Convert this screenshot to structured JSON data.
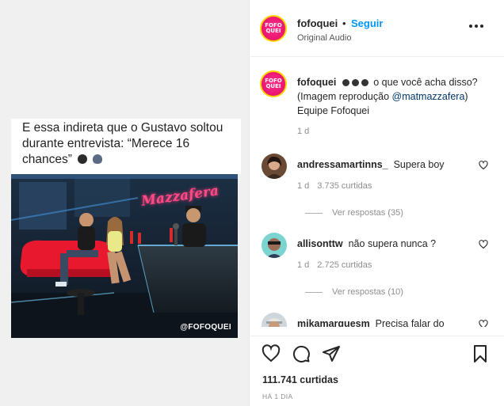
{
  "media": {
    "caption_line1": "E essa indireta que o Gustavo soltou",
    "caption_line2": "durante entrevista: “Merece 16",
    "caption_line3": "chances”",
    "brand_sign": "Mazzafera",
    "watermark": "@FOFOQUEI"
  },
  "post": {
    "logo_text_top": "FOFO",
    "logo_text_bottom": "QUEI",
    "username": "fofoquei",
    "dot": "•",
    "follow_label": "Seguir",
    "audio": "Original Audio",
    "caption": {
      "username": "fofoquei",
      "text_after_emojis": " o que você acha disso?",
      "line2_prefix": "(Imagem reprodução ",
      "mention": "@matmazzafera",
      "line2_suffix": ")",
      "line3": "Equipe Fofoquei",
      "time": "1 d"
    }
  },
  "comments": [
    {
      "username": "andressamartinns_",
      "text": "Supera boy",
      "time": "1 d",
      "likes": "3.735 curtidas",
      "replies": "Ver respostas (35)"
    },
    {
      "username": "allisonttw",
      "text": "não supera nunca ?",
      "time": "1 d",
      "likes": "2.725 curtidas",
      "replies": "Ver respostas (10)"
    },
    {
      "username": "mikamarquesm",
      "text": "Precisa falar do"
    }
  ],
  "actions": {
    "like_icon": "heart-icon",
    "comment_icon": "comment-icon",
    "share_icon": "share-icon",
    "save_icon": "bookmark-icon"
  },
  "footer": {
    "likes": "111.741 curtidas",
    "age": "HÁ 1 DIA"
  },
  "colors": {
    "accent_blue": "#0095f6",
    "brand_pink": "#e9156f",
    "muted_text": "#8e8e8e"
  }
}
